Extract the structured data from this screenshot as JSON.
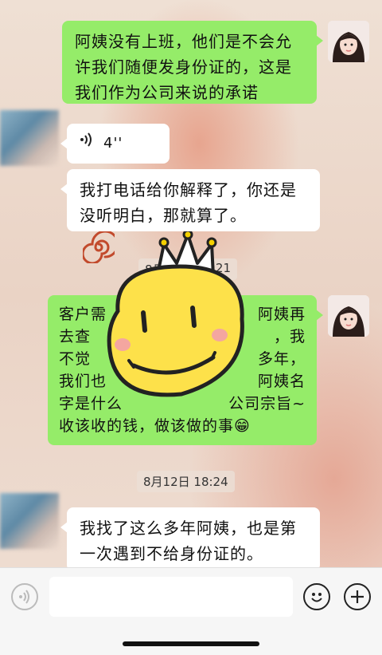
{
  "messages": [
    {
      "side": "self",
      "text": "阿姨没有上班，他们是不会允许我们随便发身份证的，这是我们作为公司来说的承诺"
    },
    {
      "side": "other",
      "type": "voice",
      "duration": "4''"
    },
    {
      "side": "other",
      "text": "我打电话给你解释了，你还是没听明白，那就算了。"
    },
    {
      "type": "time",
      "text": "8月12日 17:21"
    },
    {
      "side": "self",
      "text": "客户需要阿姨证件的，阿姨再去查原来的人信息，我不觉得，做阿姨这么多年，我们也不需要知道阿姨名字是什么，我们就按公司宗旨~收该收的钱，做该做的事😁"
    },
    {
      "type": "time",
      "text": "8月12日 18:24"
    },
    {
      "side": "other",
      "text": "我找了这么多年阿姨，也是第一次遇到不给身份证的。"
    }
  ],
  "visible": {
    "m1_line1": "阿姨没有上班，他们是不会允",
    "m1_line2": "许我们随便发身份证的，这是",
    "m1_line3": "我们作为公司来说的承诺",
    "voice_duration": "4''",
    "m3_line1": "我打电话给你解释了，你还是",
    "m3_line2": "没听明白，那就算了。",
    "time1_left": "8月",
    "time1_right": "7:21",
    "m4_line1a": "客户需",
    "m4_line1b": "阿姨再",
    "m4_line2a": "去查",
    "m4_line2b": "，我",
    "m4_line3a": "不觉",
    "m4_line3b": "多年，",
    "m4_line4a": "我们也",
    "m4_line4b": "阿姨名",
    "m4_line5a": "字是什么",
    "m4_line5b": "公司宗旨~",
    "m4_line6": "收该收的钱，做该做的事😁",
    "time2": "8月12日 18:24",
    "m5_line1": "我找了这么多年阿姨，也是第",
    "m5_line2": "一次遇到不给身份证的。"
  },
  "input_bar": {
    "voice_icon": "voice-icon",
    "emoji_icon": "emoji-icon",
    "plus_icon": "plus-icon",
    "placeholder": ""
  }
}
